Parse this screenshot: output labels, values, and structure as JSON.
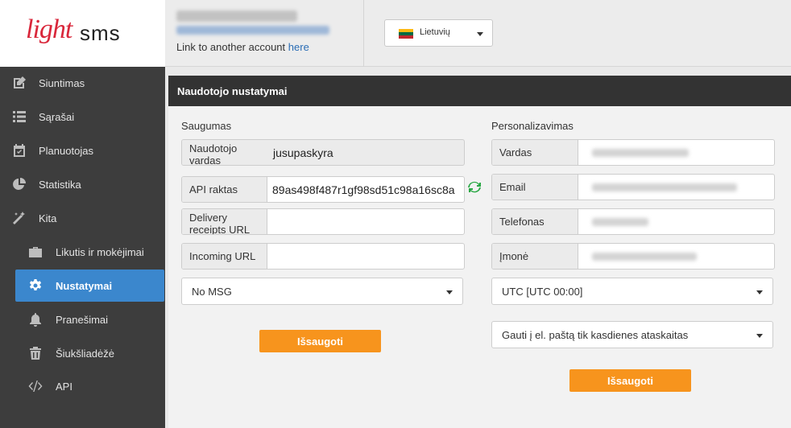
{
  "brand": {
    "light": "light",
    "sms": "sms"
  },
  "topbar": {
    "link_prefix": "Link to another account",
    "link_here": "here"
  },
  "language": {
    "selected": "Lietuvių"
  },
  "sidebar": {
    "items": [
      {
        "label": "Siuntimas",
        "icon": "edit-icon"
      },
      {
        "label": "Sąrašai",
        "icon": "list-icon"
      },
      {
        "label": "Planuotojas",
        "icon": "calendar-icon"
      },
      {
        "label": "Statistika",
        "icon": "pie-chart-icon"
      },
      {
        "label": "Kita",
        "icon": "magic-wand-icon"
      },
      {
        "label": "Likutis ir mokėjimai",
        "icon": "briefcase-icon"
      },
      {
        "label": "Nustatymai",
        "icon": "gear-icon",
        "active": true
      },
      {
        "label": "Pranešimai",
        "icon": "bell-icon"
      },
      {
        "label": "Šiukšliadėžė",
        "icon": "trash-icon"
      },
      {
        "label": "API",
        "icon": "code-icon"
      }
    ]
  },
  "panel": {
    "title": "Naudotojo nustatymai",
    "security": {
      "heading": "Saugumas",
      "username_label": "Naudotojo vardas",
      "username_value": "jusupaskyra",
      "api_key_label": "API raktas",
      "api_key_value": "89as498f487r1gf98sd51c98a16sc8a",
      "delivery_label": "Delivery receipts URL",
      "delivery_value": "",
      "incoming_label": "Incoming URL",
      "incoming_value": "",
      "msg_select": "No MSG",
      "save_label": "Išsaugoti"
    },
    "personal": {
      "heading": "Personalizavimas",
      "name_label": "Vardas",
      "email_label": "Email",
      "phone_label": "Telefonas",
      "company_label": "Įmonė",
      "timezone": "UTC [UTC 00:00]",
      "reports": "Gauti į el. paštą tik kasdienes ataskaitas",
      "save_label": "Išsaugoti"
    }
  },
  "colors": {
    "accent": "#f7941d",
    "active_nav": "#3b87cd",
    "sidebar": "#3d3d3d",
    "header": "#333333",
    "refresh": "#2aa845"
  }
}
